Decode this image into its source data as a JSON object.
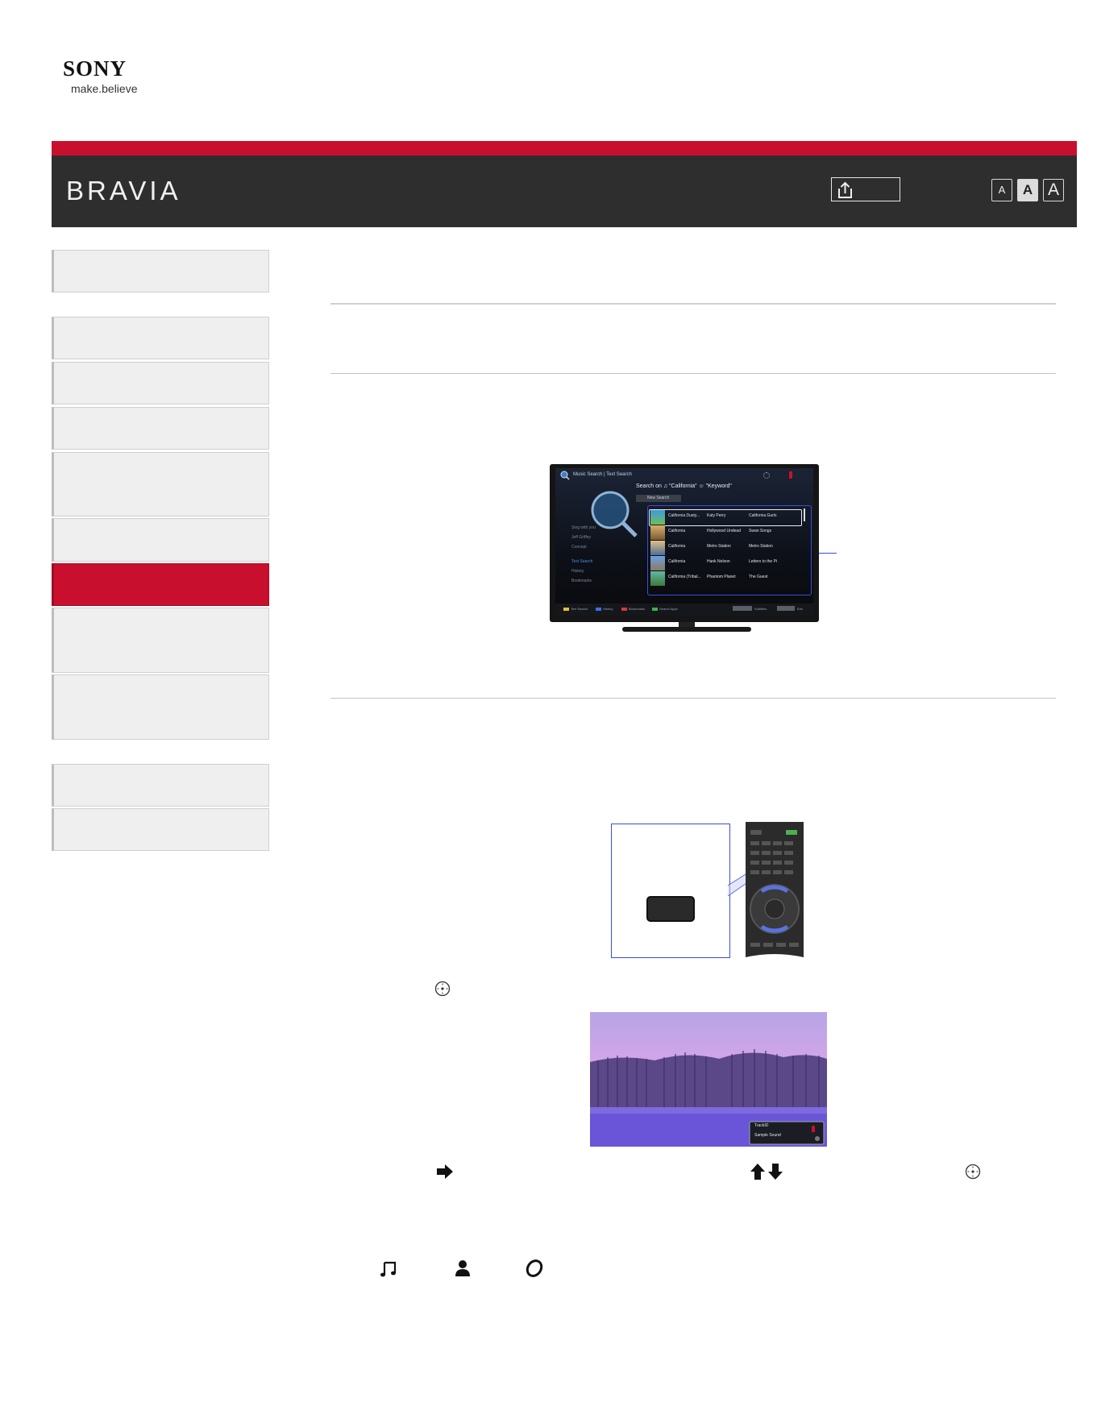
{
  "logo": {
    "brand": "SONY",
    "tagline": "make.believe"
  },
  "header": {
    "title": "BRAVIA",
    "font_size_buttons": [
      "A",
      "A",
      "A"
    ]
  },
  "sidebar": {
    "items": [
      {
        "label": ""
      },
      {
        "label": ""
      },
      {
        "label": ""
      },
      {
        "label": ""
      },
      {
        "label": ""
      },
      {
        "label": ""
      },
      {
        "label": "",
        "active": true
      },
      {
        "label": ""
      },
      {
        "label": ""
      },
      {
        "label": ""
      },
      {
        "label": ""
      }
    ]
  },
  "tv_screen": {
    "app_title": "Music Search | Text Search",
    "query_line": "Search on ♫ \"California\"  ☺ \"Keyword\"",
    "new_search": "New Search",
    "menu": [
      "Sing with you",
      "Jeff Griffey",
      "Concept",
      "Text Search",
      "History",
      "Bookmarks"
    ],
    "results": [
      {
        "title": "California Dusty...",
        "artist": "Katy Perry",
        "album": "California Gurls"
      },
      {
        "title": "California",
        "artist": "Hollywood Undead",
        "album": "Swan Songs"
      },
      {
        "title": "California",
        "artist": "Metro Station",
        "album": "Metro Station"
      },
      {
        "title": "California",
        "artist": "Hank Nelson",
        "album": "Letters to the Pi"
      },
      {
        "title": "California (Tribal...",
        "artist": "Phantom Planet",
        "album": "The Guest"
      }
    ],
    "footer_items": [
      "Text Search",
      "History",
      "Bookmarks",
      "Search Apps"
    ],
    "footer_right": [
      "Subtitles",
      "Exit"
    ]
  },
  "photo_overlay": {
    "line1": "TrackID",
    "line2": "Sample Sound"
  },
  "icons": {
    "enter": "enter-circle-icon",
    "arrow_right": "arrow-right-icon",
    "arrows_up_down": "arrow-up-down-icon",
    "music": "music-note-icon",
    "person": "person-icon",
    "album": "album-disc-icon",
    "share": "share-icon"
  },
  "colors": {
    "accent_red": "#c8102e",
    "header_dark": "#2e2e2e",
    "highlight_blue": "#3a4ed8"
  }
}
